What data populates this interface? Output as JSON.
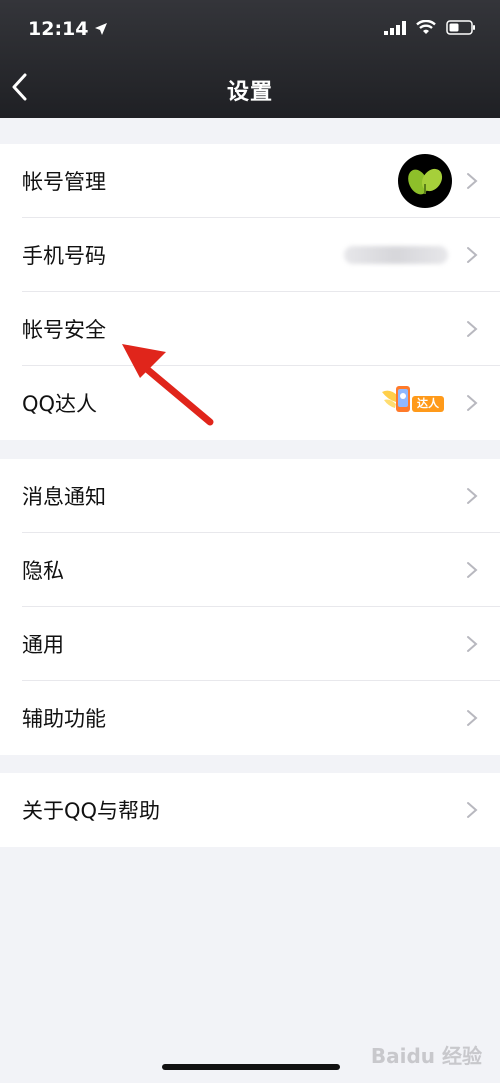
{
  "status_bar": {
    "time": "12:14"
  },
  "header": {
    "title": "设置"
  },
  "groups": [
    {
      "items": [
        {
          "label": "帐号管理"
        },
        {
          "label": "手机号码"
        },
        {
          "label": "帐号安全"
        },
        {
          "label": "QQ达人",
          "badge": "达人"
        }
      ]
    },
    {
      "items": [
        {
          "label": "消息通知"
        },
        {
          "label": "隐私"
        },
        {
          "label": "通用"
        },
        {
          "label": "辅助功能"
        }
      ]
    },
    {
      "items": [
        {
          "label": "关于QQ与帮助"
        }
      ]
    }
  ],
  "watermark": "Baidu 经验",
  "colors": {
    "header_bg": "#2a2b30",
    "page_bg": "#f2f3f7",
    "chevron": "#b8b8bf",
    "annotation_arrow": "#e0251b",
    "badge": "#ff9a1a"
  }
}
